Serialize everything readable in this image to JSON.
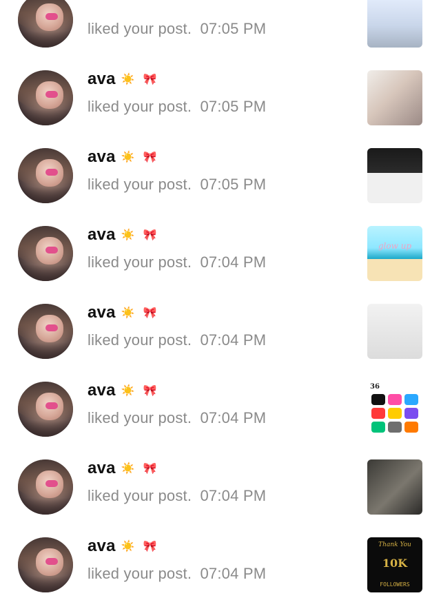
{
  "items": [
    {
      "name": "",
      "emoji_1": "",
      "emoji_2": "",
      "activity": "liked your post.",
      "time": "07:05 PM",
      "thumbnail": {
        "style": "t1",
        "text": ""
      }
    },
    {
      "name": "ava",
      "emoji_1": "☀️",
      "emoji_2": "🎀",
      "activity": "liked your post.",
      "time": "07:05 PM",
      "thumbnail": {
        "style": "t2",
        "text": ""
      }
    },
    {
      "name": "ava",
      "emoji_1": "☀️",
      "emoji_2": "🎀",
      "activity": "liked your post.",
      "time": "07:05 PM",
      "thumbnail": {
        "style": "t3",
        "text": ""
      }
    },
    {
      "name": "ava",
      "emoji_1": "☀️",
      "emoji_2": "🎀",
      "activity": "liked your post.",
      "time": "07:04 PM",
      "thumbnail": {
        "style": "t4",
        "text": "glow up"
      }
    },
    {
      "name": "ava",
      "emoji_1": "☀️",
      "emoji_2": "🎀",
      "activity": "liked your post.",
      "time": "07:04 PM",
      "thumbnail": {
        "style": "t5",
        "text": ""
      }
    },
    {
      "name": "ava",
      "emoji_1": "☀️",
      "emoji_2": "🎀",
      "activity": "liked your post.",
      "time": "07:04 PM",
      "thumbnail": {
        "style": "t6",
        "text": "36"
      }
    },
    {
      "name": "ava",
      "emoji_1": "☀️",
      "emoji_2": "🎀",
      "activity": "liked your post.",
      "time": "07:04 PM",
      "thumbnail": {
        "style": "t7",
        "text": ""
      }
    },
    {
      "name": "ava",
      "emoji_1": "☀️",
      "emoji_2": "🎀",
      "activity": "liked your post.",
      "time": "07:04 PM",
      "thumbnail": {
        "style": "t8",
        "text": "10K",
        "sub": "Thank You",
        "foot": "FOLLOWERS"
      }
    }
  ]
}
